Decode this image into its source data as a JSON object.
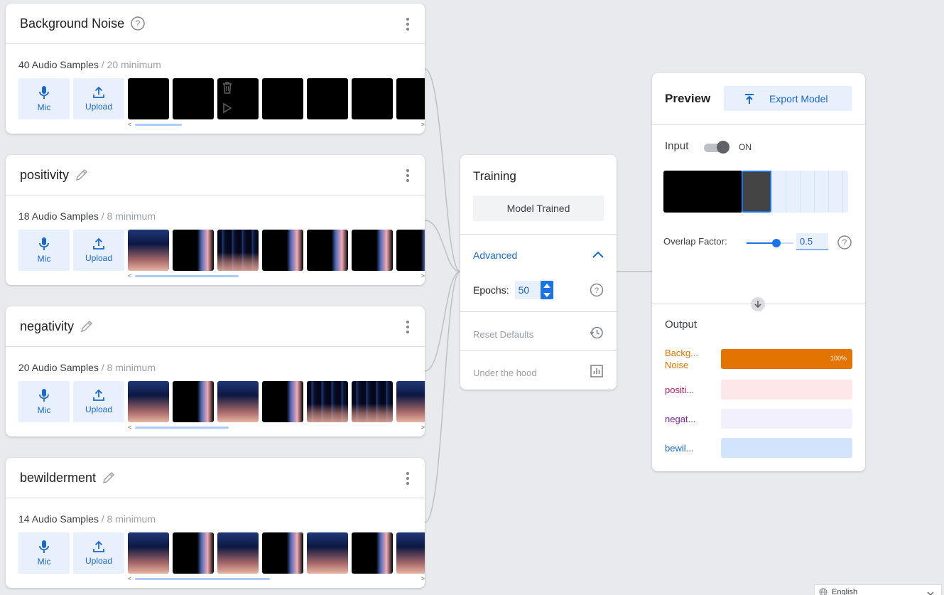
{
  "classes": [
    {
      "name": "Background Noise",
      "count": "40 Audio Samples",
      "minimum": " / 20 minimum",
      "head_icon": "help-icon",
      "thumbs": [
        "black",
        "black",
        "black-actions",
        "black",
        "black",
        "black",
        "black"
      ]
    },
    {
      "name": "positivity",
      "count": "18 Audio Samples",
      "minimum": " / 8 minimum",
      "head_icon": "pencil-icon",
      "thumbs": [
        "spec2",
        "spec3",
        "spec",
        "spec3",
        "spec3",
        "spec3",
        "spec3"
      ]
    },
    {
      "name": "negativity",
      "count": "20 Audio Samples",
      "minimum": " / 8 minimum",
      "head_icon": "pencil-icon",
      "thumbs": [
        "spec2",
        "spec3",
        "spec2",
        "spec3",
        "spec",
        "spec",
        "spec2"
      ]
    },
    {
      "name": "bewilderment",
      "count": "14 Audio Samples",
      "minimum": " / 8 minimum",
      "head_icon": "pencil-icon",
      "thumbs": [
        "spec2",
        "spec3",
        "spec2",
        "spec3",
        "spec2",
        "spec3",
        "spec2"
      ]
    }
  ],
  "sample_buttons": {
    "mic": "Mic",
    "upload": "Upload"
  },
  "training": {
    "title": "Training",
    "model_button": "Model Trained",
    "advanced": "Advanced",
    "epochs_label": "Epochs:",
    "epochs_value": "50",
    "reset_defaults": "Reset Defaults",
    "under_the_hood": "Under the hood"
  },
  "preview": {
    "title": "Preview",
    "export_button": "Export Model",
    "input_label": "Input",
    "toggle_state": "ON",
    "overlap_label": "Overlap Factor:",
    "overlap_value": "0.5",
    "overlap_fraction": 0.5,
    "output_label": "Output",
    "outputs": [
      {
        "name": "Backg... Noise",
        "pct_text": "100%",
        "value": 1.0,
        "color": "#e37400",
        "bg": "#fce8d6",
        "text_color": "#e37400"
      },
      {
        "name": "positi...",
        "pct_text": "",
        "value": 0.0,
        "color": "#ee675c",
        "bg": "#fde7e9",
        "text_color": "#c2185b"
      },
      {
        "name": "negat...",
        "pct_text": "",
        "value": 0.0,
        "color": "#7b1fa2",
        "bg": "#f3f0fd",
        "text_color": "#7b1fa2"
      },
      {
        "name": "bewil...",
        "pct_text": "",
        "value": 0.0,
        "color": "#1967d2",
        "bg": "#d2e3fc",
        "text_color": "#1967d2"
      }
    ]
  },
  "footer": {
    "language": "English"
  },
  "colors": {
    "accent": "#1a73e8",
    "accent_light": "#e8f0fe",
    "background": "#e8eaed"
  }
}
